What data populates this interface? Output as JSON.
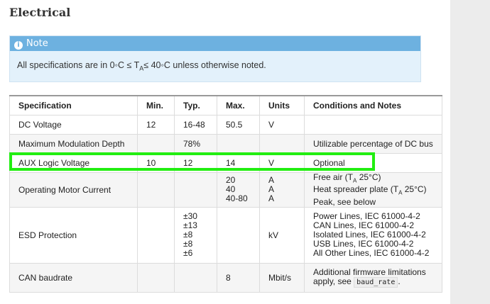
{
  "section_title": "Electrical",
  "note": {
    "label": "Note",
    "text_before": "All specifications are in 0◦C ≤ T",
    "text_sub": "A",
    "text_after": "≤ 40◦C unless otherwise noted."
  },
  "table": {
    "headers": [
      "Specification",
      "Min.",
      "Typ.",
      "Max.",
      "Units",
      "Conditions and Notes"
    ],
    "rows": [
      {
        "spec": "DC Voltage",
        "min": "12",
        "typ": "16-48",
        "max": "50.5",
        "units": "V",
        "notes": ""
      },
      {
        "spec": "Maximum Modulation Depth",
        "min": "",
        "typ": "78%",
        "max": "",
        "units": "",
        "notes": "Utilizable percentage of DC bus"
      },
      {
        "spec": "AUX Logic Voltage",
        "min": "10",
        "typ": "12",
        "max": "14",
        "units": "V",
        "notes": "Optional"
      },
      {
        "spec": "Operating Motor Current",
        "min": "",
        "typ": "",
        "max_lines": [
          "20",
          "40",
          "40-80"
        ],
        "units_lines": [
          "A",
          "A",
          "A"
        ],
        "notes_lines": [
          "Free air (T",
          "Heat spreader plate (T",
          "Peak, see below"
        ],
        "notes_sub": "A",
        "notes_suffix": " 25°C)"
      },
      {
        "spec": "ESD Protection",
        "min": "",
        "typ_lines": [
          "±30",
          "±13",
          "±8",
          "±8",
          "±6"
        ],
        "max": "",
        "units": "kV",
        "notes_lines": [
          "Power Lines, IEC 61000-4-2",
          "CAN Lines, IEC 61000-4-2",
          "Isolated Lines, IEC 61000-4-2",
          "USB Lines, IEC 61000-4-2",
          "All Other Lines, IEC 61000-4-2"
        ]
      },
      {
        "spec": "CAN baudrate",
        "min": "",
        "typ": "",
        "max": "8",
        "units": "Mbit/s",
        "notes_line1": "Additional firmware limitations",
        "notes_line2_prefix": "apply, see ",
        "notes_code": "baud_rate",
        "notes_line2_suffix": "."
      }
    ]
  },
  "colors": {
    "note_header": "#6db1e0",
    "note_body": "#e3f1fb",
    "highlight": "#22ee11"
  }
}
